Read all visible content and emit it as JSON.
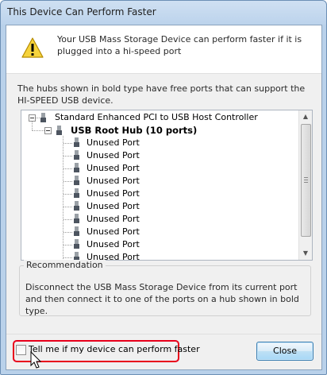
{
  "window": {
    "title": "This Device Can Perform Faster"
  },
  "message": "Your USB Mass Storage Device can perform faster if it is plugged into a hi-speed port",
  "hub_info": "The hubs shown in bold type have free ports that can support the HI-SPEED USB device.",
  "tree": {
    "controller": "Standard Enhanced PCI to USB Host Controller",
    "root_hub": "USB Root Hub (10 ports)",
    "ports": [
      "Unused Port",
      "Unused Port",
      "Unused Port",
      "Unused Port",
      "Unused Port",
      "Unused Port",
      "Unused Port",
      "Unused Port",
      "Unused Port",
      "Unused Port"
    ]
  },
  "recommendation": {
    "label": "Recommendation",
    "text": "Disconnect the USB Mass Storage Device from its current port and then connect it to one of the ports on a hub shown in bold type."
  },
  "checkbox": {
    "label": "Tell me if my device can perform faster",
    "checked": false
  },
  "buttons": {
    "close": "Close"
  },
  "colors": {
    "highlight": "#e8001b",
    "button_border": "#3c7fb1"
  }
}
